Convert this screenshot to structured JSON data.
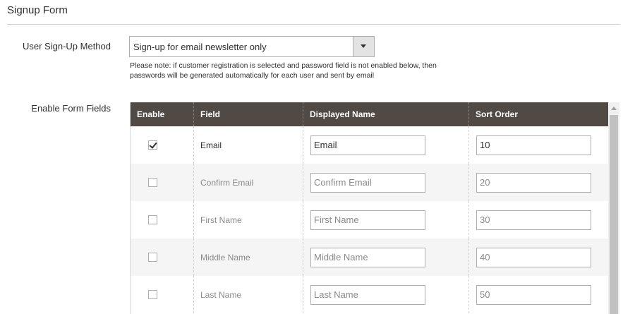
{
  "section": {
    "title": "Signup Form"
  },
  "method": {
    "label": "User Sign-Up Method",
    "selected": "Sign-up for email newsletter only",
    "note_line1": "Please note: if customer registration is selected and password field is not enabled below, then",
    "note_line2": "passwords will be generated automatically for each user and sent by email"
  },
  "fields": {
    "label": "Enable Form Fields",
    "columns": {
      "enable": "Enable",
      "field": "Field",
      "display": "Displayed Name",
      "sort": "Sort Order"
    },
    "rows": [
      {
        "enabled": true,
        "field": "Email",
        "display": "Email",
        "sort": "10"
      },
      {
        "enabled": false,
        "field": "Confirm Email",
        "display": "Confirm Email",
        "sort": "20"
      },
      {
        "enabled": false,
        "field": "First Name",
        "display": "First Name",
        "sort": "30"
      },
      {
        "enabled": false,
        "field": "Middle Name",
        "display": "Middle Name",
        "sort": "40"
      },
      {
        "enabled": false,
        "field": "Last Name",
        "display": "Last Name",
        "sort": "50"
      }
    ]
  },
  "colors": {
    "header_bg": "#514943",
    "stripe": "#f5f5f5",
    "border": "#adadad"
  }
}
